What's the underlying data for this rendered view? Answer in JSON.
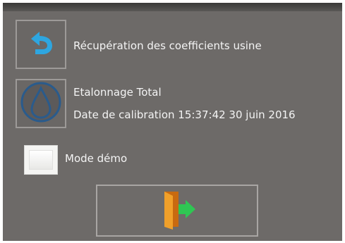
{
  "dialog": {
    "restore_label": "Récupération des coefficients usine",
    "calibration_title": "Etalonnage Total",
    "calibration_date": "Date de calibration 15:37:42 30 juin 2016",
    "demo_label": "Mode démo",
    "demo_checked": false
  },
  "icons": {
    "restore": "undo-arrow-icon",
    "calibration": "drop-icon",
    "exit": "exit-door-icon"
  },
  "colors": {
    "panel": "#6d6a68",
    "undo_arrow": "#2ea6e0",
    "drop": "#2a5b8c",
    "door": "#e88a1a",
    "exit_arrow": "#2fc653"
  }
}
